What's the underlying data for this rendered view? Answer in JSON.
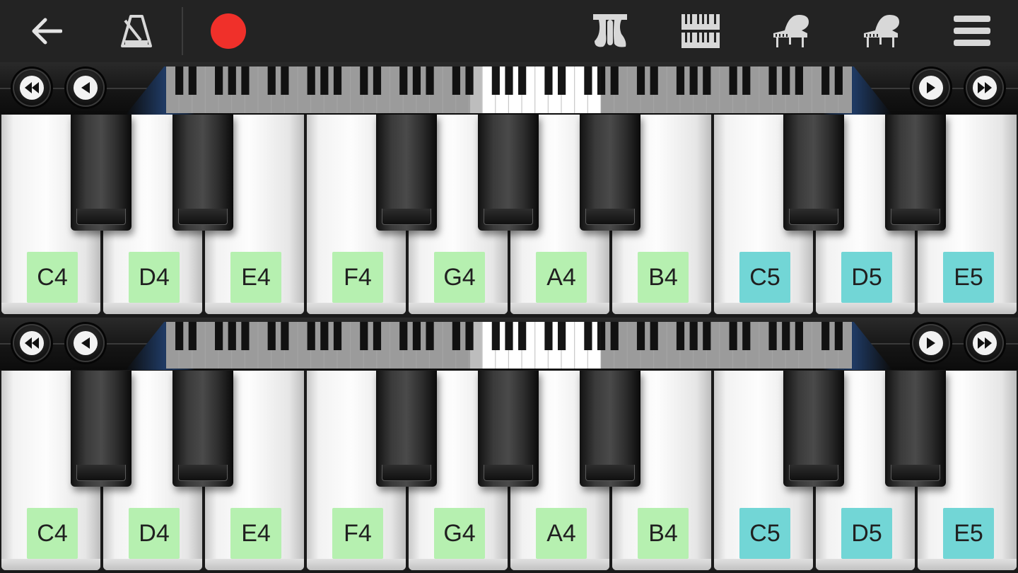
{
  "toolbar": {
    "buttons": [
      {
        "name": "back-arrow-icon"
      },
      {
        "name": "metronome-icon"
      },
      {
        "name": "record-icon",
        "color": "#f0302a"
      },
      {
        "name": "piano-mode-icon"
      },
      {
        "name": "keyboard-layout-icon"
      },
      {
        "name": "grand-piano-icon"
      },
      {
        "name": "grand-piano-alt-icon"
      },
      {
        "name": "menu-icon"
      }
    ]
  },
  "colors": {
    "label_octave_4": "#b6f0b0",
    "label_octave_5": "#72d6d6",
    "record": "#f0302a"
  },
  "keyboard_upper": {
    "nav_buttons": [
      "fast-rewind-icon",
      "rewind-icon",
      "forward-icon",
      "fast-forward-icon"
    ],
    "white_keys": [
      {
        "label": "C4",
        "octave": 4
      },
      {
        "label": "D4",
        "octave": 4
      },
      {
        "label": "E4",
        "octave": 4
      },
      {
        "label": "F4",
        "octave": 4
      },
      {
        "label": "G4",
        "octave": 4
      },
      {
        "label": "A4",
        "octave": 4
      },
      {
        "label": "B4",
        "octave": 4
      },
      {
        "label": "C5",
        "octave": 5
      },
      {
        "label": "D5",
        "octave": 5
      },
      {
        "label": "E5",
        "octave": 5
      }
    ]
  },
  "keyboard_lower": {
    "nav_buttons": [
      "fast-rewind-icon",
      "rewind-icon",
      "forward-icon",
      "fast-forward-icon"
    ],
    "white_keys": [
      {
        "label": "C4",
        "octave": 4
      },
      {
        "label": "D4",
        "octave": 4
      },
      {
        "label": "E4",
        "octave": 4
      },
      {
        "label": "F4",
        "octave": 4
      },
      {
        "label": "G4",
        "octave": 4
      },
      {
        "label": "A4",
        "octave": 4
      },
      {
        "label": "B4",
        "octave": 4
      },
      {
        "label": "C5",
        "octave": 5
      },
      {
        "label": "D5",
        "octave": 5
      },
      {
        "label": "E5",
        "octave": 5
      }
    ]
  }
}
